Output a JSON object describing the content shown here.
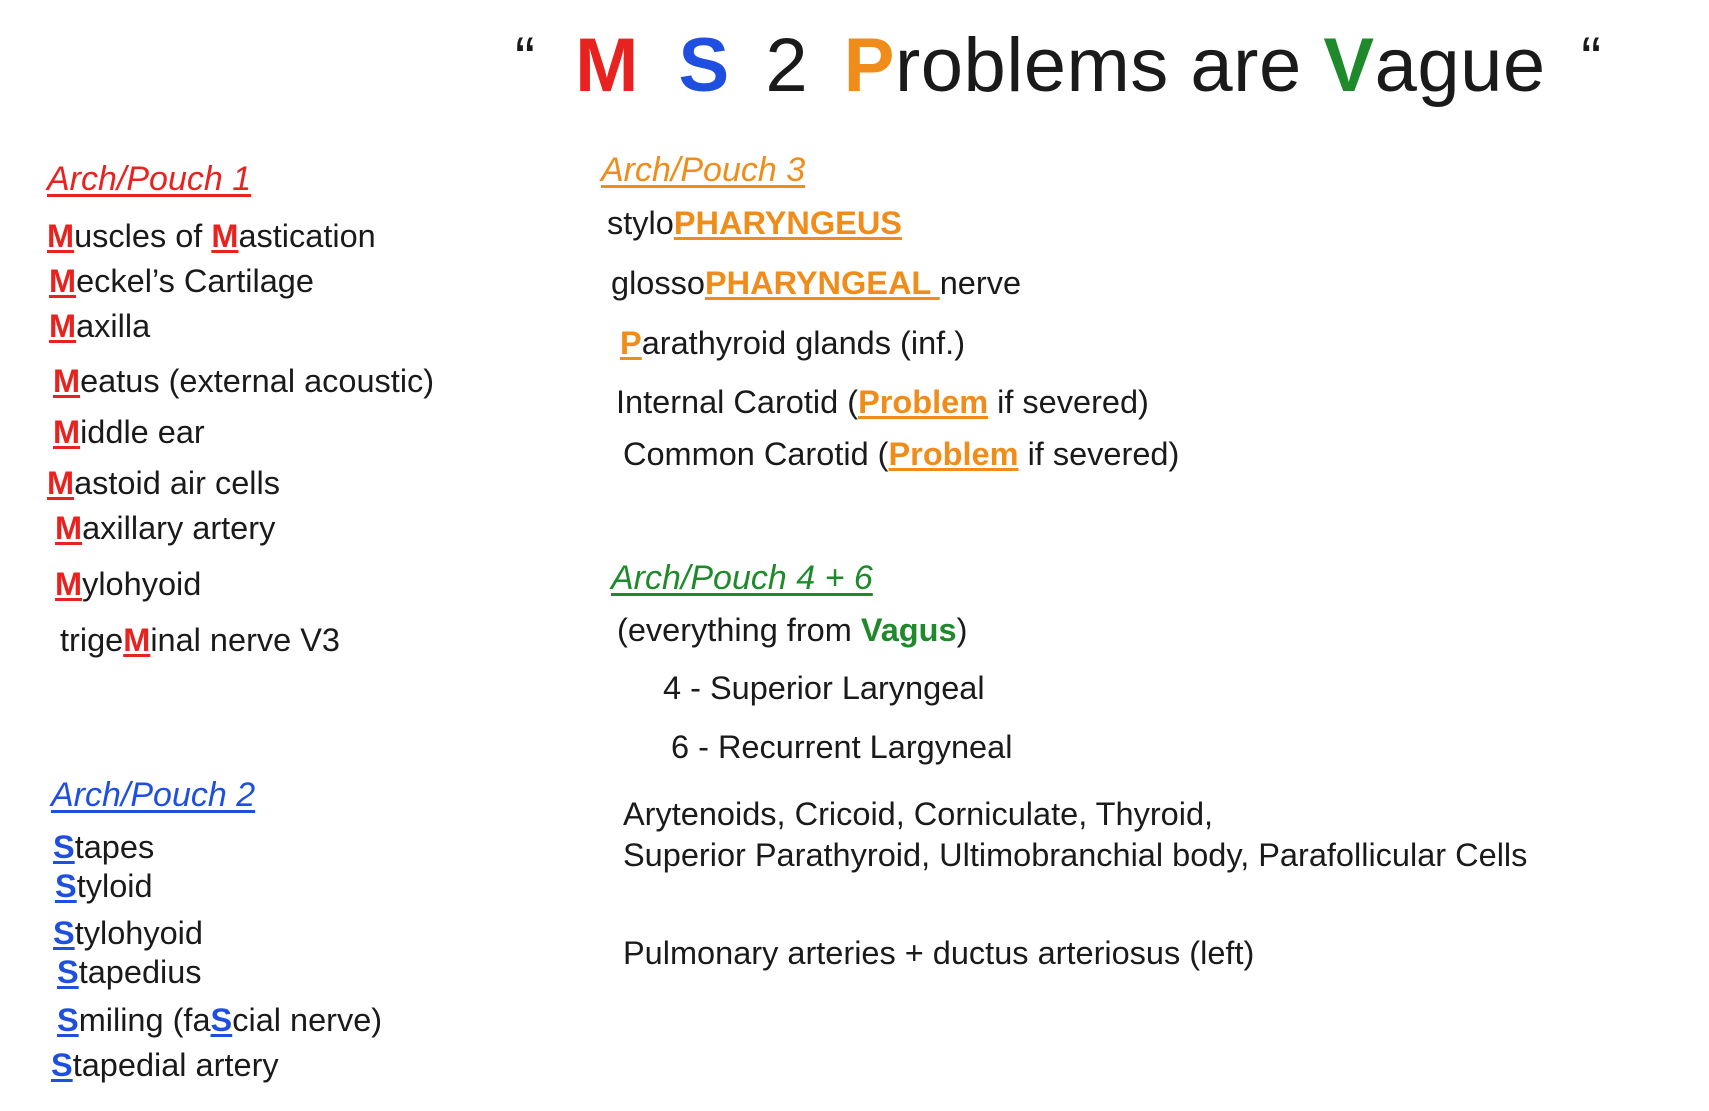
{
  "colors": {
    "m": "#e8231f",
    "s": "#1f4fe0",
    "p": "#f08c1a",
    "v": "#1f8a2b",
    "text": "#1a1a1a"
  },
  "title": {
    "open_quote": "“",
    "m": "M",
    "s": "S",
    "two": "2",
    "p": "P",
    "roblems_are": "roblems are",
    "v": "V",
    "ague": "ague",
    "close_quote": "“"
  },
  "arch1": {
    "heading": "Arch/Pouch 1",
    "items": [
      {
        "a": "",
        "hl": "M",
        "b": "uscles of ",
        "hl2": "M",
        "c": "astication"
      },
      {
        "a": "",
        "hl": "M",
        "b": "eckel’s Cartilage"
      },
      {
        "a": "",
        "hl": "M",
        "b": "axilla"
      },
      {
        "a": "",
        "hl": "M",
        "b": "eatus (external acoustic)"
      },
      {
        "a": "",
        "hl": "M",
        "b": "iddle ear"
      },
      {
        "a": "",
        "hl": "M",
        "b": "astoid air cells"
      },
      {
        "a": "",
        "hl": "M",
        "b": "axillary artery"
      },
      {
        "a": "",
        "hl": "M",
        "b": "ylohyoid"
      },
      {
        "a": "trige",
        "hl": "M",
        "b": "inal nerve V3"
      }
    ]
  },
  "arch2": {
    "heading": "Arch/Pouch 2",
    "items": [
      {
        "a": "",
        "hl": "S",
        "b": "tapes"
      },
      {
        "a": "",
        "hl": "S",
        "b": "tyloid"
      },
      {
        "a": "",
        "hl": "S",
        "b": "tylohyoid"
      },
      {
        "a": "",
        "hl": "S",
        "b": "tapedius"
      },
      {
        "a": "",
        "hl": "S",
        "b": "miling (fa",
        "hl2": "S",
        "c": "cial nerve)"
      },
      {
        "a": "",
        "hl": "S",
        "b": "tapedial artery"
      }
    ]
  },
  "arch3": {
    "heading": "Arch/Pouch 3",
    "items": [
      {
        "a": "stylo",
        "hl": "PHARYNGEUS",
        "b": ""
      },
      {
        "a": "glosso",
        "hl": "PHARYNGEAL ",
        "b": "nerve"
      },
      {
        "a": "",
        "hl": "P",
        "b": "arathyroid glands (inf.)"
      },
      {
        "a": "Internal Carotid (",
        "hl": "Problem",
        "b": " if severed)"
      },
      {
        "a": "Common Carotid (",
        "hl": "Problem",
        "b": " if severed)"
      }
    ]
  },
  "arch46": {
    "heading": "Arch/Pouch 4 + 6",
    "intro": {
      "a": "(everything from ",
      "hl": "Vagus",
      "b": ")"
    },
    "sup": "4 - Superior Laryngeal",
    "rec": "6 - Recurrent Largyneal",
    "list1": "Arytenoids, Cricoid, Corniculate, Thyroid,",
    "list2": "Superior Parathyroid, Ultimobranchial body, Parafollicular Cells",
    "pulm": "Pulmonary arteries + ductus arteriosus (left)"
  }
}
